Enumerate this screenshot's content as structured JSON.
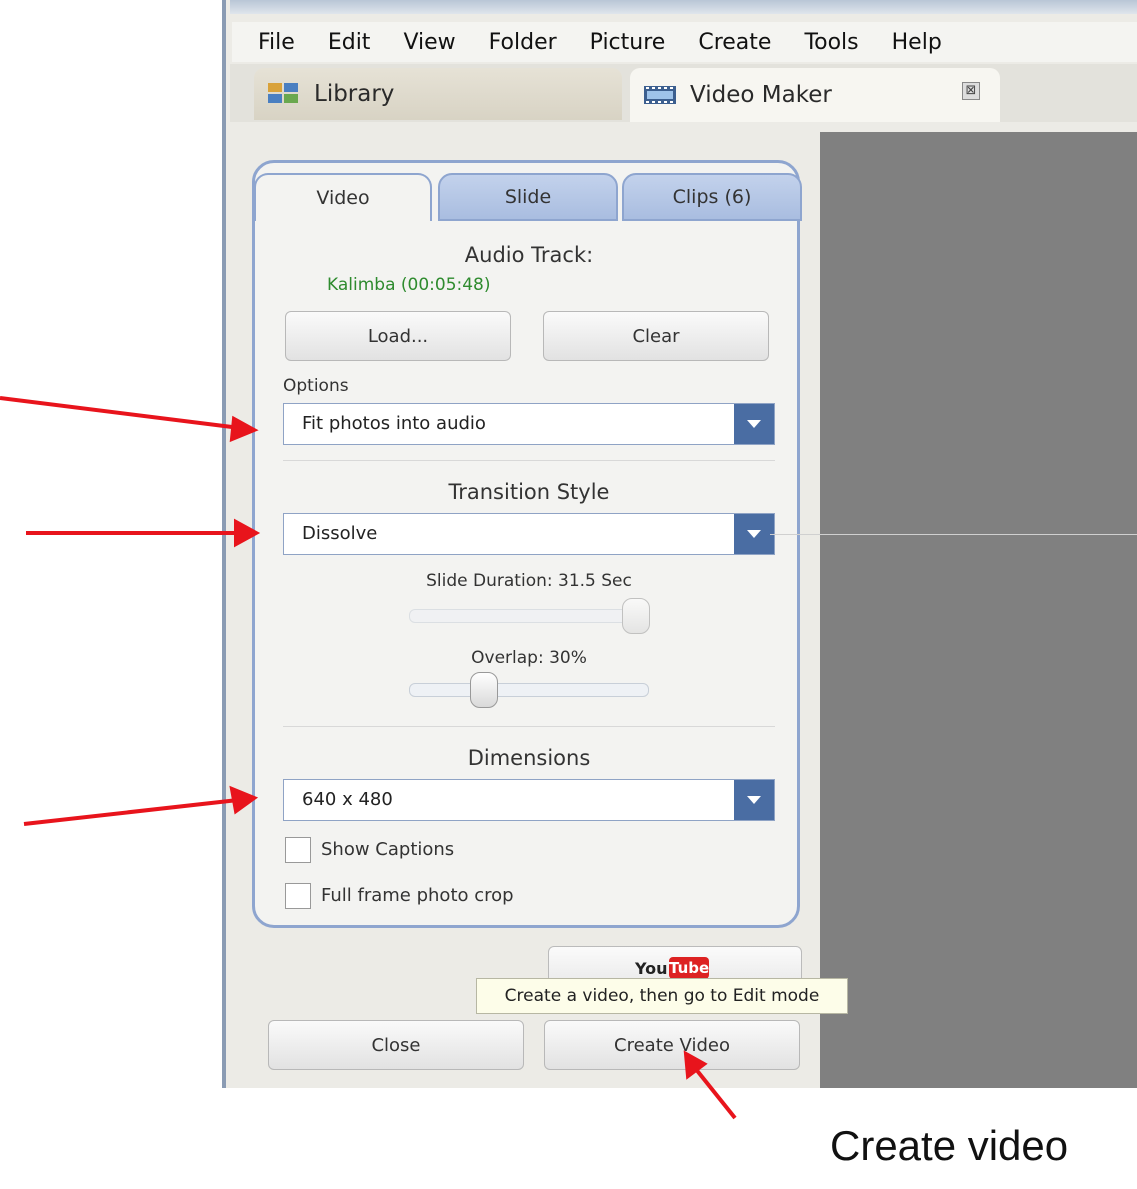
{
  "menu": [
    "File",
    "Edit",
    "View",
    "Folder",
    "Picture",
    "Create",
    "Tools",
    "Help"
  ],
  "tabs": {
    "library": "Library",
    "video_maker": "Video Maker",
    "close_symbol": "⊠"
  },
  "panel": {
    "tabs": [
      "Video",
      "Slide",
      "Clips (6)"
    ],
    "audio_track_label": "Audio Track:",
    "audio_track_value": "Kalimba (00:05:48)",
    "load_button": "Load...",
    "clear_button": "Clear",
    "options_label": "Options",
    "options_value": "Fit photos into audio",
    "transition_label": "Transition Style",
    "transition_value": "Dissolve",
    "slide_duration": "Slide Duration: 31.5 Sec",
    "overlap": "Overlap: 30%",
    "dimensions_label": "Dimensions",
    "dimensions_value": "640 x 480",
    "show_captions": "Show Captions",
    "full_frame": "Full frame photo crop"
  },
  "youtube": {
    "you": "You",
    "tube": "Tube"
  },
  "tooltip": "Create a video, then go to Edit mode",
  "buttons": {
    "close": "Close",
    "create": "Create Video"
  },
  "annotation": "Create video",
  "colors": {
    "accent": "#4a6da3",
    "arrow": "#e8141c",
    "preview": "#808080"
  }
}
